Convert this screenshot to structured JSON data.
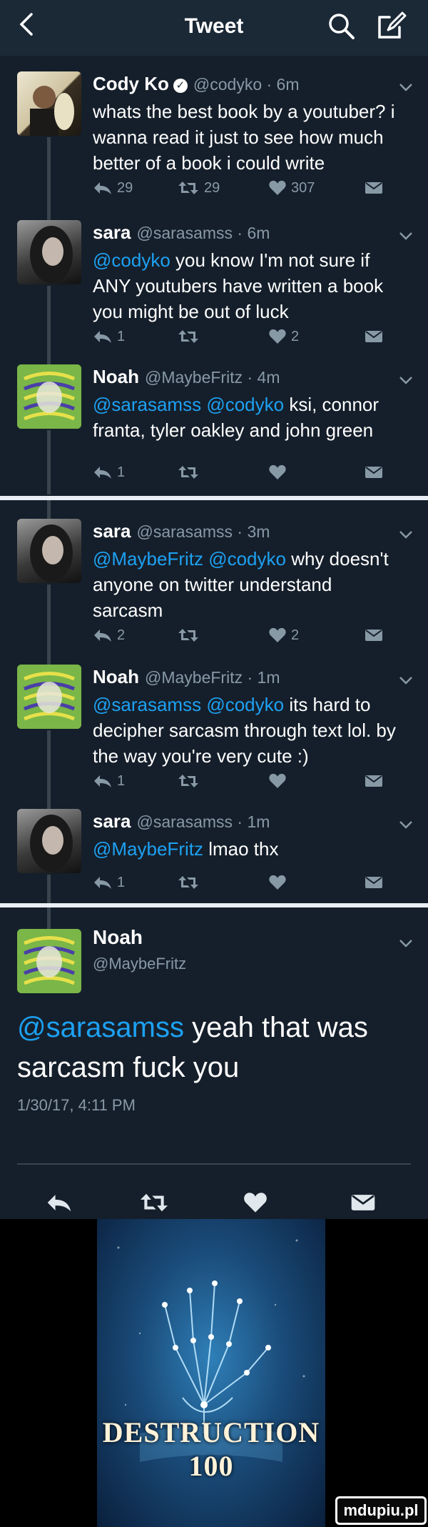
{
  "header": {
    "title": "Tweet",
    "back_icon": "chevron-left-icon",
    "search_icon": "search-icon",
    "compose_icon": "compose-icon"
  },
  "colors": {
    "background": "#151f2b",
    "mention": "#1da1f2",
    "muted": "#8899a6"
  },
  "replies": [
    {
      "name": "Cody Ko",
      "verified": true,
      "handle": "@codyko · 6m",
      "text": "whats the best book by a youtuber? i wanna read it just to see how much better of a book i could write",
      "counts": {
        "reply": "29",
        "retweet": "29",
        "like": "307"
      }
    },
    {
      "name": "sara",
      "handle": "@sarasamss · 6m",
      "mentions": "@codyko",
      "text": " you know I'm not sure if ANY youtubers have written a book you might be out of luck",
      "counts": {
        "reply": "1",
        "retweet": "",
        "like": "2"
      }
    },
    {
      "name": "Noah",
      "handle": "@MaybeFritz · 4m",
      "mentions": "@sarasamss @codyko",
      "text": " ksi, connor franta, tyler oakley and john green",
      "counts": {
        "reply": "1",
        "retweet": "",
        "like": ""
      }
    },
    {
      "name": "sara",
      "handle": "@sarasamss · 3m",
      "mentions": "@MaybeFritz @codyko",
      "text": " why doesn't anyone on twitter understand sarcasm",
      "counts": {
        "reply": "2",
        "retweet": "",
        "like": "2"
      }
    },
    {
      "name": "Noah",
      "handle": "@MaybeFritz · 1m",
      "mentions": "@sarasamss @codyko",
      "text": " its hard to decipher sarcasm through text lol. by the way you're very cute :)",
      "counts": {
        "reply": "1",
        "retweet": "",
        "like": ""
      }
    },
    {
      "name": "sara",
      "handle": "@sarasamss · 1m",
      "mentions": "@MaybeFritz",
      "text": " lmao thx",
      "counts": {
        "reply": "1",
        "retweet": "",
        "like": ""
      }
    }
  ],
  "main_tweet": {
    "name": "Noah",
    "handle": "@MaybeFritz",
    "mention": "@sarasamss",
    "text": " yeah that was sarcasm fuck you",
    "timestamp": "1/30/17, 4:11 PM"
  },
  "meme": {
    "caption": "DESTRUCTION 100"
  },
  "watermark": "mdupiu.pl"
}
